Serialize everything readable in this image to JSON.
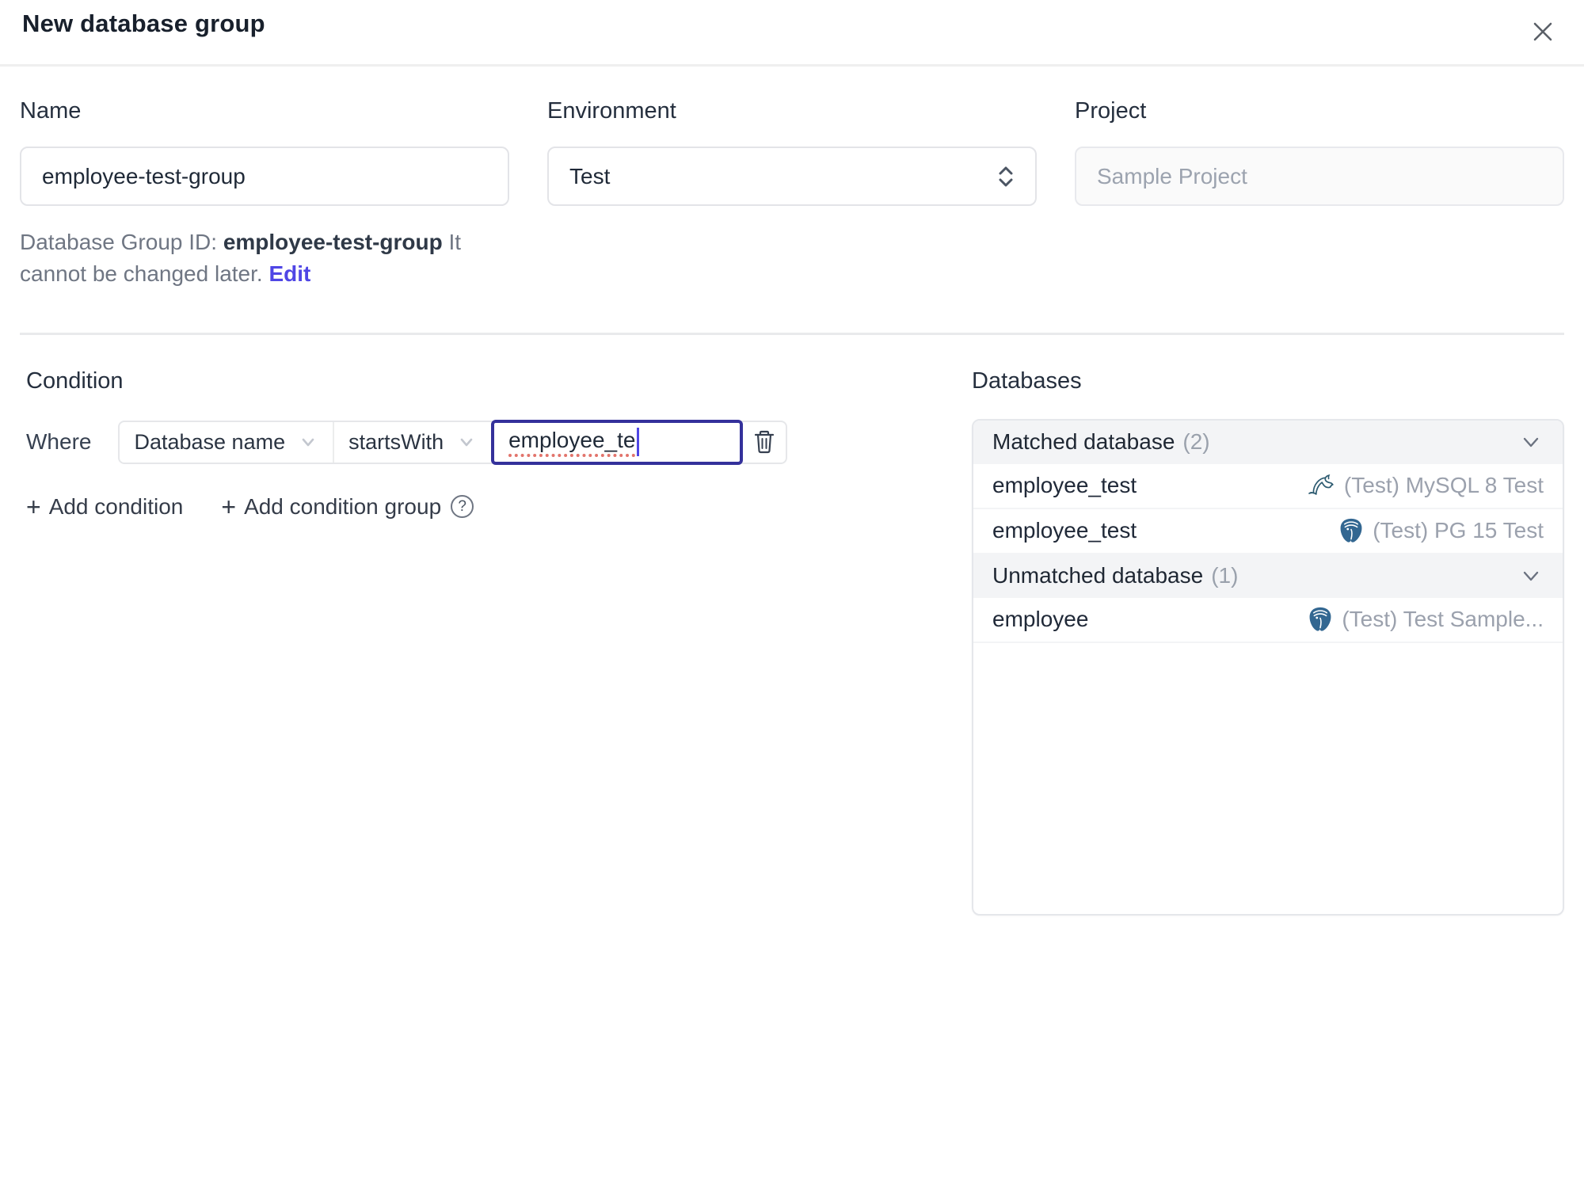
{
  "colors": {
    "accent": "#4f46e5",
    "focus_border": "#34319b",
    "postgres_blue": "#336791",
    "mysql_teal": "#2c5a70",
    "panel_header_bg": "#f3f4f6",
    "muted_text": "#9ca3af"
  },
  "dialog": {
    "title": "New database group"
  },
  "form": {
    "name": {
      "label": "Name",
      "value": "employee-test-group"
    },
    "environment": {
      "label": "Environment",
      "value": "Test"
    },
    "project": {
      "label": "Project",
      "value": "Sample Project"
    },
    "id_note": {
      "prefix": "Database Group ID: ",
      "id": "employee-test-group",
      "suffix": " It cannot be changed later. ",
      "edit": "Edit"
    }
  },
  "condition": {
    "heading": "Condition",
    "where": "Where",
    "field": "Database name",
    "operator": "startsWith",
    "value": "employee_te",
    "plus": "+",
    "add_condition": "Add condition",
    "add_condition_group": "Add condition group",
    "help": "?"
  },
  "databases": {
    "heading": "Databases",
    "matched": {
      "title": "Matched database",
      "count": "(2)"
    },
    "unmatched": {
      "title": "Unmatched database",
      "count": "(1)"
    },
    "rows": {
      "matched": [
        {
          "name": "employee_test",
          "engine": "mysql",
          "instance": "(Test) MySQL 8 Test"
        },
        {
          "name": "employee_test",
          "engine": "postgres",
          "instance": "(Test) PG 15 Test"
        }
      ],
      "unmatched": [
        {
          "name": "employee",
          "engine": "postgres",
          "instance": "(Test) Test Sample..."
        }
      ]
    }
  }
}
